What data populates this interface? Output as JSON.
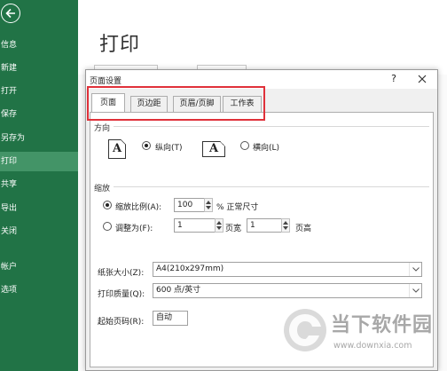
{
  "sidebar": {
    "items": [
      {
        "label": "信息"
      },
      {
        "label": "新建"
      },
      {
        "label": "打开"
      },
      {
        "label": "保存"
      },
      {
        "label": "另存为"
      },
      {
        "label": "打印",
        "active": true
      },
      {
        "label": "共享"
      },
      {
        "label": "导出"
      },
      {
        "label": "关闭"
      },
      {
        "label": "帐户"
      },
      {
        "label": "选项"
      }
    ]
  },
  "backstage": {
    "title": "打印"
  },
  "dialog": {
    "title": "页面设置",
    "help": "?",
    "tabs": [
      {
        "label": "页面",
        "active": true
      },
      {
        "label": "页边距"
      },
      {
        "label": "页眉/页脚"
      },
      {
        "label": "工作表"
      }
    ],
    "orientation": {
      "section": "方向",
      "portrait_label": "纵向(T)",
      "landscape_label": "横向(L)",
      "selected": "portrait",
      "icon_letter": "A"
    },
    "scaling": {
      "section": "缩放",
      "adjust_label": "缩放比例(A):",
      "adjust_value": "100",
      "adjust_suffix": "% 正常尺寸",
      "fit_label": "调整为(F):",
      "fit_wide_value": "1",
      "fit_wide_suffix": "页宽",
      "fit_tall_value": "1",
      "fit_tall_suffix": "页高",
      "selected": "adjust"
    },
    "paper_size": {
      "label": "纸张大小(Z):",
      "value": "A4(210x297mm)"
    },
    "print_quality": {
      "label": "打印质量(Q):",
      "value": "600 点/英寸"
    },
    "first_page": {
      "label": "起始页码(R):",
      "value": "自动"
    }
  },
  "watermark": {
    "brand": "当下软件园",
    "url": "www.downxia.com"
  },
  "colors": {
    "sidebar": "#217346",
    "sidebar_active": "#439467",
    "highlight": "#e0313a"
  }
}
